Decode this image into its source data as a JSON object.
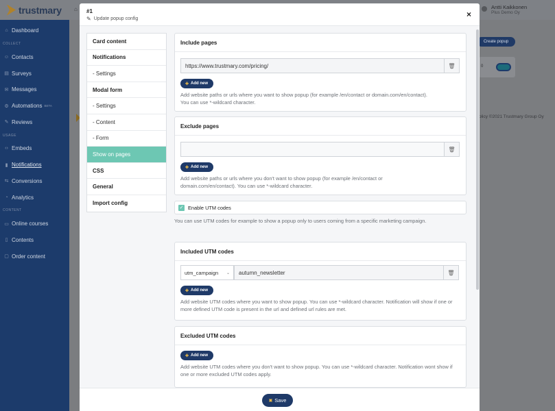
{
  "app": {
    "brand": "trustmary",
    "user_name": "Antti Kaikkonen",
    "user_org": "Plus Demo Oy"
  },
  "sidebar": {
    "items": [
      {
        "label": "Dashboard",
        "icon": "home-icon"
      },
      {
        "section": "COLLECT"
      },
      {
        "label": "Contacts",
        "icon": "users-icon"
      },
      {
        "label": "Surveys",
        "icon": "survey-icon"
      },
      {
        "label": "Messages",
        "icon": "mail-icon"
      },
      {
        "label": "Automations",
        "icon": "automation-icon",
        "badge": "BETA"
      },
      {
        "label": "Reviews",
        "icon": "reviews-icon"
      },
      {
        "section": "USAGE"
      },
      {
        "label": "Embeds",
        "icon": "code-icon"
      },
      {
        "label": "Notifications",
        "icon": "notification-icon",
        "active": true
      },
      {
        "label": "Conversions",
        "icon": "conversion-icon"
      },
      {
        "label": "Analytics",
        "icon": "analytics-icon"
      },
      {
        "section": "CONTENT"
      },
      {
        "label": "Online courses",
        "icon": "course-icon"
      },
      {
        "label": "Contents",
        "icon": "contents-icon"
      },
      {
        "label": "Order content",
        "icon": "order-icon"
      }
    ]
  },
  "background": {
    "create_popup_label": "Create popup",
    "count": "0",
    "footer": "olicy  ©2021 Trustmary Group Oy"
  },
  "modal": {
    "id": "#1",
    "subtitle": "Update popup config",
    "close_label": "×",
    "save_label": "Save"
  },
  "menu": {
    "card_content": "Card content",
    "notifications": "Notifications",
    "notifications_settings": "- Settings",
    "modal_form": "Modal form",
    "modal_settings": "- Settings",
    "modal_content": "- Content",
    "modal_form_sub": "- Form",
    "show_on_pages": "Show on pages",
    "css": "CSS",
    "general": "General",
    "import_config": "Import config"
  },
  "include_pages": {
    "title": "Include pages",
    "value": "https://www.trustmary.com/pricing/",
    "add_label": "Add new",
    "help": "Add website paths or urls where you want to show popup (for example /en/contact or domain.com/en/contact). You can use *-wildcard character."
  },
  "exclude_pages": {
    "title": "Exclude pages",
    "value": "",
    "add_label": "Add new",
    "help": "Add website paths or urls where you don't want to show popup (for example /en/contact or domain.com/en/contact). You can use *-wildcard character."
  },
  "utm": {
    "enable_label": "Enable UTM codes",
    "enabled": true,
    "help": "You can use UTM codes for example to show a popup only to users coming from a specific marketing campaign."
  },
  "included_utm": {
    "title": "Included UTM codes",
    "param": "utm_campaign",
    "value": "autumn_newsletter",
    "add_label": "Add new",
    "help": "Add website UTM codes where you want to show popup. You can use *-wildcard character. Notification will show if one or more defined UTM code is present in the url and defined url rules are met."
  },
  "excluded_utm": {
    "title": "Excluded UTM codes",
    "add_label": "Add new",
    "help": "Add website UTM codes where you don't want to show popup. You can use *-wildcard character. Notification wont show if one or more excluded UTM codes apply."
  },
  "colors": {
    "sidebar": "#1c3b6b",
    "accent": "#6dc7b3",
    "button": "#1f3a68"
  }
}
